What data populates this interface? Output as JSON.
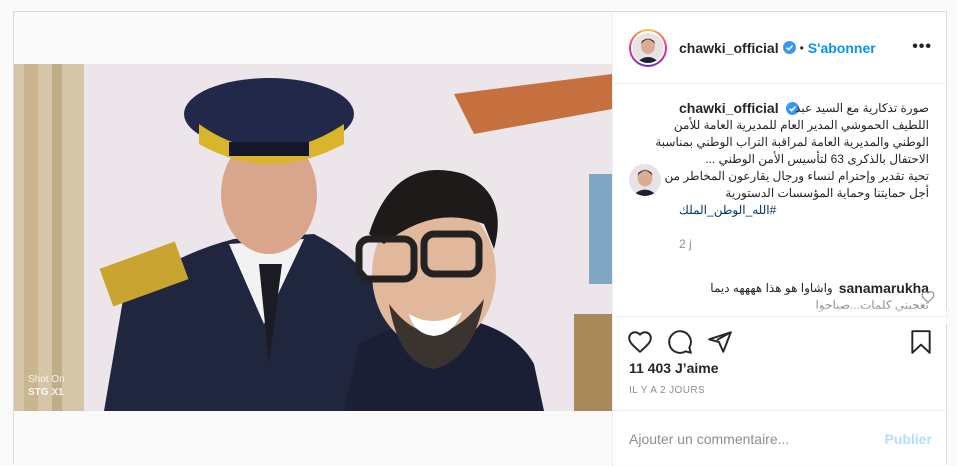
{
  "header": {
    "username": "chawki_official",
    "separator": "•",
    "follow_label": "S'abonner",
    "more_label": "•••"
  },
  "caption": {
    "username": "chawki_official",
    "lines": [
      "صورة تذكارية مع السيد عبد",
      "اللطيف الحموشي المدير العام للمديرية العامة للأمن",
      "الوطني والمديرية العامة لمراقبة التراب الوطني بمناسبة",
      "الاحتفال بالذكرى 63 لتأسيس الأمن الوطني ...",
      "تحية تقدير وإحترام لنساء ورجال يقارعون المخاطر من",
      "أجل حمايتنا وحماية المؤسسات الدستورية"
    ],
    "hashtag": "#الله_الوطن_الملك",
    "time": "2 j"
  },
  "comment": {
    "username": "sanamarukha",
    "text": "واشاوا هو هذا ههههه ديما",
    "text2": "تعجبني كلمات...صباحوا"
  },
  "photo_watermark": {
    "line1": "Shot On",
    "line2": "STG X1"
  },
  "likes": "11 403 J’aime",
  "time_ago": "IL Y A 2 JOURS",
  "comment_input": {
    "placeholder": "Ajouter un commentaire..."
  },
  "publish_label": "Publier",
  "icons": {
    "like": "heart-icon",
    "comment": "comment-icon",
    "share": "share-icon",
    "save": "bookmark-icon",
    "verified": "verified-badge-icon"
  },
  "colors": {
    "link": "#0095f6",
    "publish_disabled": "#b2dffc",
    "hashtag": "#00376b"
  }
}
